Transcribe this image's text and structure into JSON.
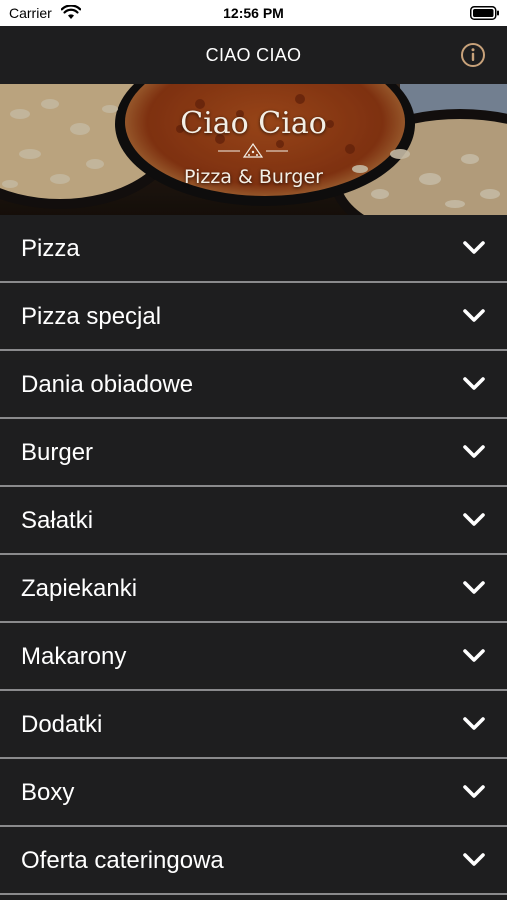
{
  "status_bar": {
    "carrier": "Carrier",
    "time": "12:56 PM"
  },
  "nav": {
    "title": "CIAO CIAO",
    "info_icon": "info-circle-icon",
    "info_color": "#c8a27a"
  },
  "banner": {
    "title": "Ciao Ciao",
    "subtitle": "Pizza & Burger"
  },
  "categories": [
    {
      "label": "Pizza"
    },
    {
      "label": "Pizza specjal"
    },
    {
      "label": "Dania obiadowe"
    },
    {
      "label": "Burger"
    },
    {
      "label": "Sałatki"
    },
    {
      "label": "Zapiekanki"
    },
    {
      "label": "Makarony"
    },
    {
      "label": "Dodatki"
    },
    {
      "label": "Boxy"
    },
    {
      "label": "Oferta cateringowa"
    }
  ],
  "colors": {
    "background": "#1e1e1f",
    "divider": "#8a8a8c",
    "text": "#ffffff"
  }
}
